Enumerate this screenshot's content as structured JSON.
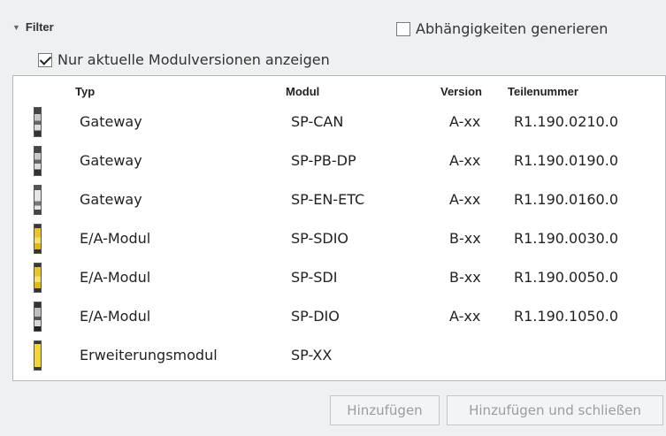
{
  "filter": {
    "label": "Filter",
    "generate_dependencies": {
      "label": "Abhängigkeiten generieren",
      "checked": false
    },
    "current_versions_only": {
      "label": "Nur aktuelle Modulversionen anzeigen",
      "checked": true
    }
  },
  "table": {
    "columns": [
      "Typ",
      "Modul",
      "Version",
      "Teilenummer"
    ],
    "rows": [
      {
        "typ": "Gateway",
        "modul": "SP-CAN",
        "version": "A-xx",
        "teilenummer": "R1.190.0210.0",
        "icon": "gateway-module-icon"
      },
      {
        "typ": "Gateway",
        "modul": "SP-PB-DP",
        "version": "A-xx",
        "teilenummer": "R1.190.0190.0",
        "icon": "gateway-module-icon"
      },
      {
        "typ": "Gateway",
        "modul": "SP-EN-ETC",
        "version": "A-xx",
        "teilenummer": "R1.190.0160.0",
        "icon": "gateway-module-icon"
      },
      {
        "typ": "E/A-Modul",
        "modul": "SP-SDIO",
        "version": "B-xx",
        "teilenummer": "R1.190.0030.0",
        "icon": "io-module-yellow-icon"
      },
      {
        "typ": "E/A-Modul",
        "modul": "SP-SDI",
        "version": "B-xx",
        "teilenummer": "R1.190.0050.0",
        "icon": "io-module-yellow-icon"
      },
      {
        "typ": "E/A-Modul",
        "modul": "SP-DIO",
        "version": "A-xx",
        "teilenummer": "R1.190.1050.0",
        "icon": "io-module-gray-icon"
      },
      {
        "typ": "Erweiterungsmodul",
        "modul": "SP-XX",
        "version": "",
        "teilenummer": "",
        "icon": "extension-module-icon"
      }
    ]
  },
  "buttons": {
    "add": "Hinzufügen",
    "add_and_close": "Hinzufügen und schließen"
  }
}
